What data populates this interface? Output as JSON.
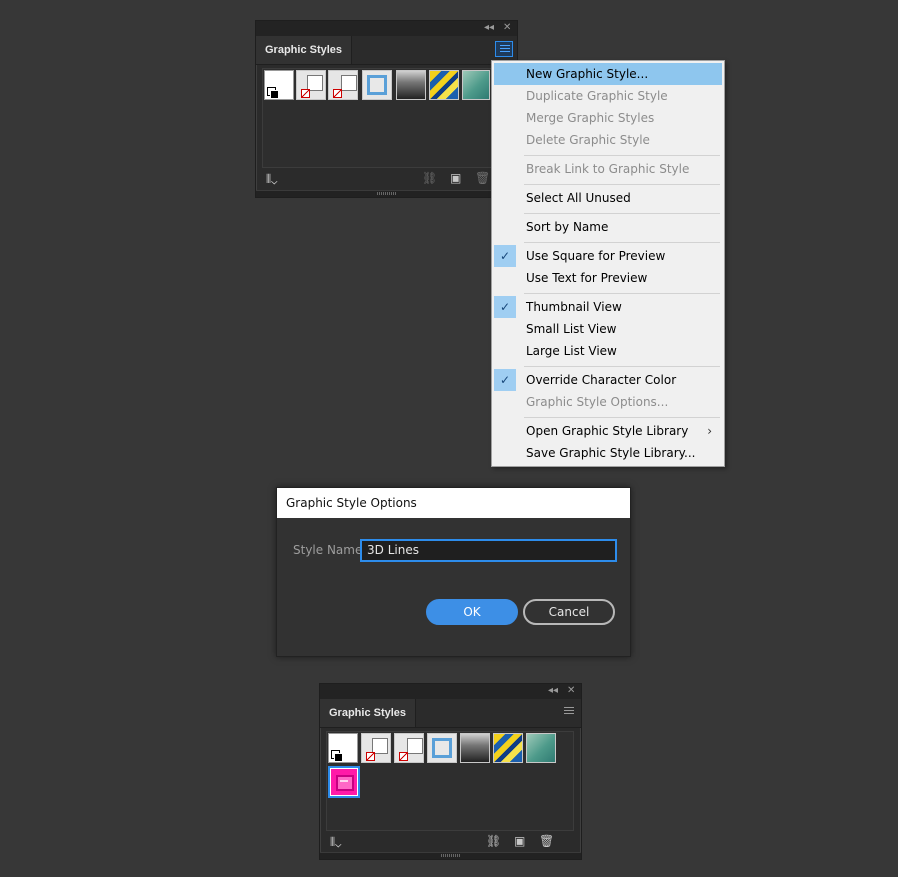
{
  "panel_top": {
    "tab_label": "Graphic Styles",
    "collapse_glyph": "◂◂",
    "close_glyph": "✕",
    "swatches": [
      "default-style",
      "no-fill-stroke",
      "no-fill-stroke-2",
      "blue-stroke-frame",
      "gray-gradient",
      "yellow-blue-pattern",
      "teal-leaf"
    ]
  },
  "menu": {
    "items": [
      {
        "label": "New Graphic Style...",
        "state": "highlighted"
      },
      {
        "label": "Duplicate Graphic Style",
        "state": "disabled"
      },
      {
        "label": "Merge Graphic Styles",
        "state": "disabled"
      },
      {
        "label": "Delete Graphic Style",
        "state": "disabled"
      },
      {
        "label": "Break Link to Graphic Style",
        "state": "disabled"
      },
      {
        "label": "Select All Unused",
        "state": "enabled"
      },
      {
        "label": "Sort by Name",
        "state": "enabled"
      },
      {
        "label": "Use Square for Preview",
        "state": "checked"
      },
      {
        "label": "Use Text for Preview",
        "state": "enabled"
      },
      {
        "label": "Thumbnail View",
        "state": "checked"
      },
      {
        "label": "Small List View",
        "state": "enabled"
      },
      {
        "label": "Large List View",
        "state": "enabled"
      },
      {
        "label": "Override Character Color",
        "state": "checked"
      },
      {
        "label": "Graphic Style Options...",
        "state": "disabled"
      },
      {
        "label": "Open Graphic Style Library",
        "state": "submenu"
      },
      {
        "label": "Save Graphic Style Library...",
        "state": "enabled"
      }
    ],
    "check_glyph": "✓",
    "submenu_glyph": "›"
  },
  "dialog": {
    "title": "Graphic Style Options",
    "style_name_label": "Style Name:",
    "style_name_value": "3D Lines",
    "ok_label": "OK",
    "cancel_label": "Cancel"
  },
  "panel_bottom": {
    "tab_label": "Graphic Styles",
    "collapse_glyph": "◂◂",
    "close_glyph": "✕",
    "swatches": [
      "default-style",
      "no-fill-stroke",
      "no-fill-stroke-2",
      "blue-stroke-frame",
      "gray-gradient",
      "yellow-blue-pattern",
      "teal-leaf",
      "pink-3d-lines"
    ],
    "selected_swatch": "pink-3d-lines"
  },
  "colors": {
    "accent": "#2d8ceb",
    "menu_highlight": "#8ec6ee",
    "pink": "#ff1aa8"
  }
}
